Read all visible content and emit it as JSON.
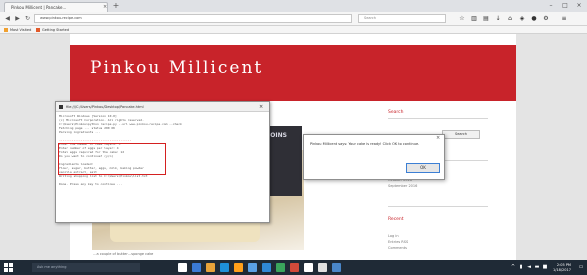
{
  "browser": {
    "tab_title": "Pinkou Millicent | Pancake...",
    "tab_close": "×",
    "new_tab": "+",
    "window_controls": {
      "minimize": "–",
      "maximize": "□",
      "close": "×"
    },
    "url": "www.pinkou-recipe.com",
    "search_placeholder": "Search",
    "bookmarks": [
      "Most Visited",
      "Getting Started"
    ],
    "icons": [
      "back-icon",
      "forward-icon",
      "reload-icon",
      "star-icon",
      "library-icon",
      "bookmark-icon",
      "download-icon",
      "home-icon",
      "pocket-icon",
      "menu-icon"
    ]
  },
  "page": {
    "hero_title": "Pinkou Millicent",
    "photo_label": "JOINS",
    "caption": "…a couple of butter…sponge cake",
    "sidebar": {
      "heading_1": "Search",
      "search_button": "Search",
      "heading_2": "Archives",
      "heading_3": "Recent",
      "links_1": [
        "categories",
        "October 2016",
        "September 2016"
      ],
      "links_2": [
        "Log in",
        "Entries RSS",
        "Comments"
      ]
    }
  },
  "console": {
    "title": "file:///C:/Users/Pinkou/Desktop/Pancake.html",
    "close": "×",
    "lines": [
      "Microsoft Windows [Version 10.0]",
      "(c) Microsoft Corporation. All rights reserved.",
      "C:\\Users\\Pinkou>python recipe.py --url www.pinkou-recipe.com --check",
      "Fetching page ... status 200 OK",
      "Parsing ingredients ...",
      "",
      "----------------------------------------",
      "Enter the number of cake layers: 3",
      "Enter number of eggs per layer: 4",
      "Total eggs required for the cake: 12",
      "Do you want to continue? (y/n)",
      "",
      "Ingredients loaded:",
      "  flour, sugar, butter, eggs, milk, baking powder",
      "  vanilla extract, salt",
      "Writing shopping list to C:\\Users\\Pinkou\\list.txt",
      "",
      "Done. Press any key to continue ..."
    ]
  },
  "dialog": {
    "message": "Pinkou Millicent says: Your cake is ready! Click OK to continue.",
    "ok": "OK",
    "close": "×"
  },
  "taskbar": {
    "search_placeholder": "Ask me anything",
    "time": "2:05 PM",
    "date": "1/18/2017",
    "app_colors": [
      "#ffffff",
      "#3b7bd6",
      "#e8a33a",
      "#1e90d8",
      "#ff9f1a",
      "#5aa1e6",
      "#2f88d6",
      "#3aa55c",
      "#d14a3a",
      "#ffffff",
      "#e0e0e0",
      "#4a86c8"
    ],
    "accent": "#c8232a"
  }
}
